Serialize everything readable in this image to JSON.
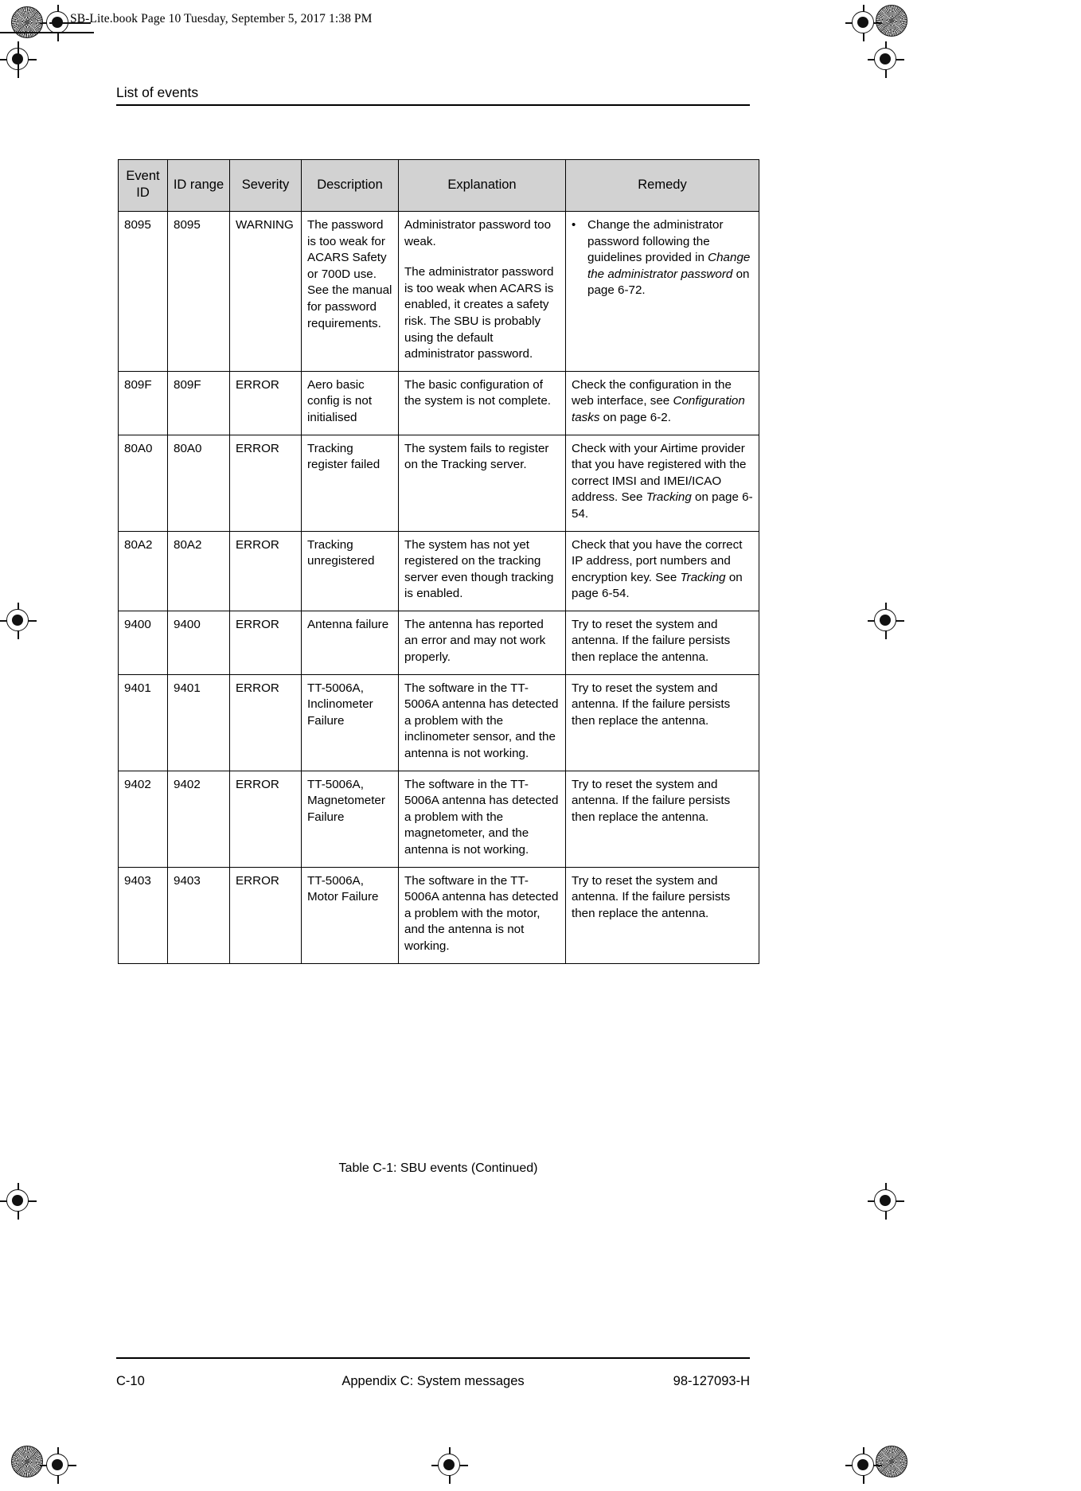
{
  "page": {
    "book_slug": "SB-Lite.book  Page 10  Tuesday, September 5, 2017  1:38 PM",
    "running_header": "List of events",
    "caption": "Table C-1: SBU events  (Continued)",
    "footer": {
      "left": "C-10",
      "center": "Appendix C:  System messages",
      "right": "98-127093-H"
    }
  },
  "table": {
    "headers": [
      "Event ID",
      "ID range",
      "Severity",
      "Description",
      "Explanation",
      "Remedy"
    ],
    "rows": [
      {
        "event_id": "8095",
        "id_range": "8095",
        "severity": "WARNING",
        "description": "The password is too weak for ACARS Safety or 700D use. See the manual for password requirements.",
        "explanation_p1": "Administrator password too weak.",
        "explanation_p2": "The administrator password is too weak when ACARS is enabled, it creates a safety risk. The SBU is probably using the default administrator password.",
        "remedy_bullet_pre": "Change the administrator password following the guidelines provided in ",
        "remedy_bullet_italic": "Change the administrator password",
        "remedy_bullet_post": " on page 6-72."
      },
      {
        "event_id": "809F",
        "id_range": "809F",
        "severity": "ERROR",
        "description": "Aero basic config is not initialised",
        "explanation": "The basic configuration of the system is not complete.",
        "remedy_pre": "Check the configuration in the web interface, see ",
        "remedy_italic": "Configuration tasks",
        "remedy_post": " on page 6-2."
      },
      {
        "event_id": "80A0",
        "id_range": "80A0",
        "severity": "ERROR",
        "description": "Tracking register failed",
        "explanation": "The system fails to register on the Tracking server.",
        "remedy_pre": "Check with your Airtime provider that you have registered with the correct IMSI and IMEI/ICAO address. See ",
        "remedy_italic": "Tracking",
        "remedy_post": " on page 6-54."
      },
      {
        "event_id": "80A2",
        "id_range": "80A2",
        "severity": "ERROR",
        "description": "Tracking unregistered",
        "explanation": "The system has not yet registered on the tracking server even though tracking is enabled.",
        "remedy_pre": "Check that you have the correct IP address, port numbers and encryption key. See ",
        "remedy_italic": "Tracking",
        "remedy_post": " on page 6-54."
      },
      {
        "event_id": "9400",
        "id_range": "9400",
        "severity": "ERROR",
        "description": "Antenna failure",
        "explanation": "The antenna has reported an error and may not work properly.",
        "remedy_pre": "Try to reset the system and antenna. If the failure persists then replace the antenna.",
        "remedy_italic": "",
        "remedy_post": ""
      },
      {
        "event_id": "9401",
        "id_range": "9401",
        "severity": "ERROR",
        "description": "TT-5006A, Inclinometer Failure",
        "explanation": "The software in the TT-5006A antenna has detected a problem with the inclinometer sensor, and the antenna is not working.",
        "remedy_pre": "Try to reset the system and antenna. If the failure persists then replace the antenna.",
        "remedy_italic": "",
        "remedy_post": ""
      },
      {
        "event_id": "9402",
        "id_range": "9402",
        "severity": "ERROR",
        "description": "TT-5006A, Magnetometer Failure",
        "explanation": "The software in the TT-5006A antenna has detected a problem with the magnetometer, and the antenna is not working.",
        "remedy_pre": "Try to reset the system and antenna. If the failure persists then replace the antenna.",
        "remedy_italic": "",
        "remedy_post": ""
      },
      {
        "event_id": "9403",
        "id_range": "9403",
        "severity": "ERROR",
        "description": "TT-5006A, Motor Failure",
        "explanation": "The software in the TT-5006A antenna has detected a problem with the motor, and the antenna is not working.",
        "remedy_pre": "Try to reset the system and antenna. If the failure persists then replace the antenna.",
        "remedy_italic": "",
        "remedy_post": ""
      }
    ]
  },
  "colors": {
    "header_fill": "#d2d2d2",
    "border": "#000000",
    "page_background": "#ffffff"
  }
}
